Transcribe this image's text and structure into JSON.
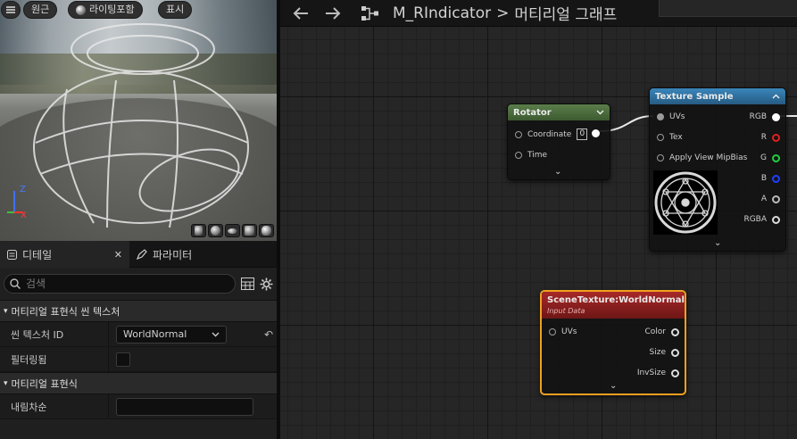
{
  "viewport": {
    "buttons": {
      "perspective": "원근",
      "lighting": "라이팅포함",
      "show": "표시"
    },
    "axes": {
      "z": "Z",
      "x": "X"
    }
  },
  "details": {
    "tabs": [
      {
        "label": "디테일",
        "close": "✕"
      },
      {
        "label": "파라미터"
      }
    ],
    "search_placeholder": "검색",
    "categories": [
      {
        "title": "머티리얼 표현식 씬 텍스처",
        "rows": [
          {
            "name": "씬 텍스처 ID",
            "value": "WorldNormal"
          },
          {
            "name": "필터링됨"
          }
        ]
      },
      {
        "title": "머티리얼 표현식",
        "rows": [
          {
            "name": "내림차순"
          }
        ]
      }
    ]
  },
  "graph": {
    "breadcrumb": {
      "asset": "M_RIndicator",
      "separator": ">",
      "graph": "머티리얼 그래프"
    },
    "nodes": {
      "rotator": {
        "title": "Rotator",
        "inputs": [
          "Coordinate",
          "Time"
        ],
        "coordinate_value": "0",
        "color": "#4a6b3e"
      },
      "texture_sample": {
        "title": "Texture Sample",
        "inputs": [
          "UVs",
          "Tex",
          "Apply View MipBias"
        ],
        "outputs": [
          "RGB",
          "R",
          "G",
          "B",
          "A",
          "RGBA"
        ],
        "color": "#2e6e99"
      },
      "scene_texture": {
        "title": "SceneTexture:WorldNormal",
        "subtitle": "Input Data",
        "inputs": [
          "UVs"
        ],
        "outputs": [
          "Color",
          "Size",
          "InvSize"
        ],
        "color": "#8e1f1f",
        "selection_color": "#f0a020"
      }
    }
  }
}
